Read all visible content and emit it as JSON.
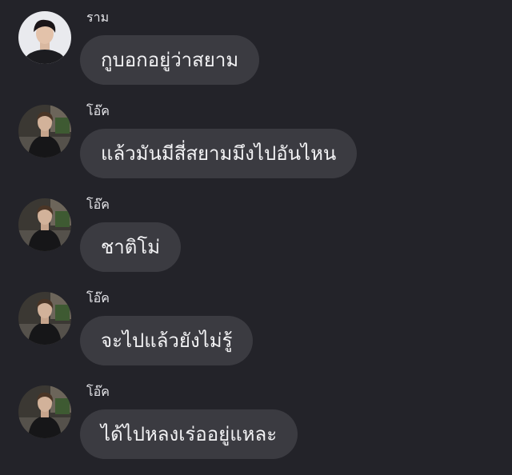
{
  "messages": [
    {
      "sender": "ราม",
      "text": "กูบอกอยู่ว่าสยาม",
      "avatar_icon": "user-avatar-ram"
    },
    {
      "sender": "โอ๊ค",
      "text": "แล้วมันมีสี่สยามมึงไปอันไหน",
      "avatar_icon": "user-avatar-oak"
    },
    {
      "sender": "โอ๊ค",
      "text": "ชาติโม่",
      "avatar_icon": "user-avatar-oak"
    },
    {
      "sender": "โอ๊ค",
      "text": "จะไปแล้วยังไม่รู้",
      "avatar_icon": "user-avatar-oak"
    },
    {
      "sender": "โอ๊ค",
      "text": "ได้ไปหลงเร่ออยู่แหละ",
      "avatar_icon": "user-avatar-oak"
    }
  ],
  "colors": {
    "background": "#232329",
    "bubble": "#3b3b41",
    "text": "#f2f2f4"
  }
}
